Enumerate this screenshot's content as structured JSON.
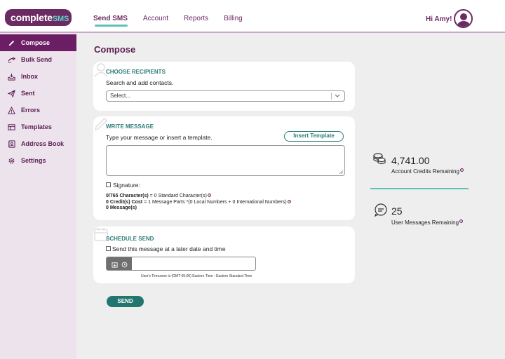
{
  "logo": {
    "main": "complete",
    "suffix": "SMS"
  },
  "topnav": [
    {
      "label": "Send SMS",
      "active": true
    },
    {
      "label": "Account",
      "active": false
    },
    {
      "label": "Reports",
      "active": false
    },
    {
      "label": "Billing",
      "active": false
    }
  ],
  "user": {
    "greeting": "Hi Amy!",
    "avatar_icon": "user-avatar-icon"
  },
  "sidebar": {
    "items": [
      {
        "label": "Compose",
        "icon": "pencil-icon",
        "active": true
      },
      {
        "label": "Bulk Send",
        "icon": "bulk-send-icon",
        "active": false
      },
      {
        "label": "Inbox",
        "icon": "inbox-icon",
        "active": false
      },
      {
        "label": "Sent",
        "icon": "paper-plane-icon",
        "active": false
      },
      {
        "label": "Errors",
        "icon": "warning-icon",
        "active": false
      },
      {
        "label": "Templates",
        "icon": "templates-icon",
        "active": false
      },
      {
        "label": "Address Book",
        "icon": "address-book-icon",
        "active": false
      },
      {
        "label": "Settings",
        "icon": "gear-icon",
        "active": false
      }
    ]
  },
  "page": {
    "title": "Compose"
  },
  "recipients": {
    "heading": "CHOOSE RECIPIENTS",
    "hint": "Search and add contacts.",
    "select_value": "Select..."
  },
  "message": {
    "heading": "WRITE MESSAGE",
    "hint": "Type your message or insert a template.",
    "insert_template": "Insert Template",
    "textarea_value": "",
    "signature_label": "Signature:",
    "characters_bold": "0/765 Character(s)",
    "characters_rest": " = 0 Standard Character(s)",
    "credits_bold": "0 Credit(s) Cost",
    "credits_rest": " = 1 Message Parts *(0 Local Numbers + 0 International Numbers)",
    "messages_bold": "0 Message(s)"
  },
  "schedule": {
    "heading": "SCHEDULE SEND",
    "checkbox_label": "Send this message at a later date and time",
    "datetime_value": "",
    "timezone_note": "User's Timezone is (GMT-05:00) Eastern Time - Eastern Standard Time"
  },
  "send_label": "SEND",
  "stats": {
    "credits_value": "4,741.00",
    "credits_label": "Account Credits Remaining",
    "messages_value": "25",
    "messages_label": "User Messages Remaining"
  },
  "colors": {
    "brand": "#6b2a62",
    "accent": "#5cc2b5",
    "primary_button": "#23756f"
  }
}
